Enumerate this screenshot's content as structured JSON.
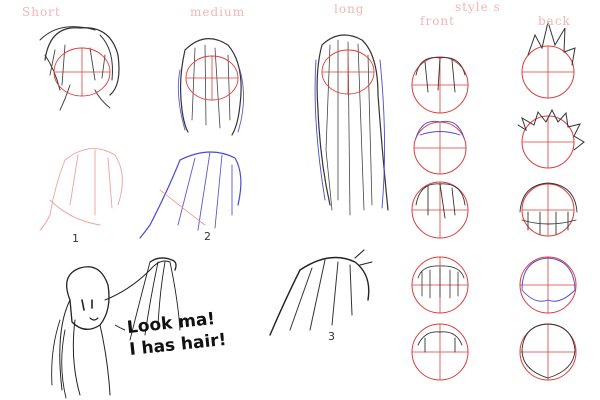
{
  "labels": {
    "short": "Short",
    "medium": "medium",
    "long": "long",
    "styles": "style s",
    "front": "front",
    "back": "back"
  },
  "numbers": {
    "one": "1",
    "two": "2",
    "three": "3"
  },
  "speech": {
    "line1": "Look ma!",
    "line2": "I has hair!"
  },
  "colors": {
    "guide_red": "#e23b3b",
    "ink": "#2a2a2a",
    "blue_ink": "#4a4ad8",
    "label_pink": "#f2b6b6"
  }
}
